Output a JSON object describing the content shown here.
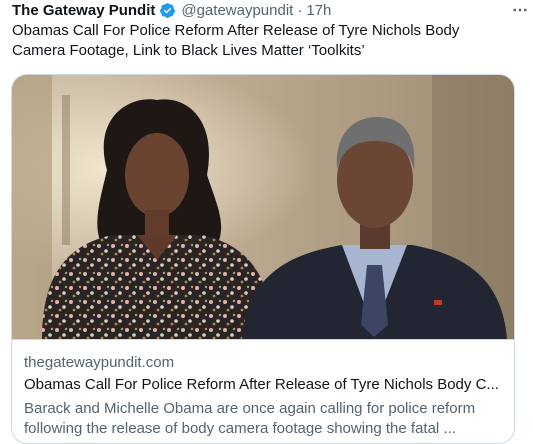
{
  "tweet": {
    "author_name": "The Gateway Pundit",
    "handle": "@gatewaypundit",
    "separator": "·",
    "time": "17h",
    "verified_icon": "verified-badge-icon",
    "more_icon": "more-options-icon",
    "text": "Obamas Call For Police Reform After Release of Tyre Nichols Body Camera Footage, Link to Black Lives Matter ‘Toolkits’"
  },
  "card": {
    "domain": "thegatewaypundit.com",
    "title": "Obamas Call For Police Reform After Release of Tyre Nichols Body C...",
    "description": "Barack and Michelle Obama are once again calling for police reform following the release of body camera footage showing the fatal ..."
  },
  "colors": {
    "verified": "#1d9bf0",
    "secondary_text": "#536471",
    "border": "#cfd9de",
    "primary_text": "#0f1419"
  }
}
